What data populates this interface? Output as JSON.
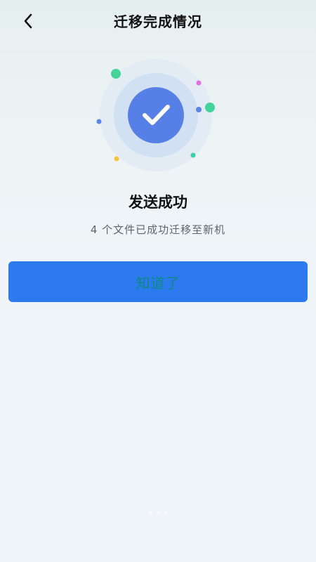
{
  "header": {
    "title": "迁移完成情况",
    "back_icon": "chevron-left-icon"
  },
  "result": {
    "icon": "check-icon",
    "title": "发送成功",
    "subtitle": "4 个文件已成功迁移至新机"
  },
  "actions": {
    "ok_label": "知道了"
  },
  "colors": {
    "accent": "#2d79ee",
    "check_circle": "#5680e6",
    "button_text": "#0d8a85",
    "dot_green": "#46d39a",
    "dot_blue": "#5a86e6",
    "dot_pink": "#e46ee0",
    "dot_yellow": "#f3c23e"
  }
}
